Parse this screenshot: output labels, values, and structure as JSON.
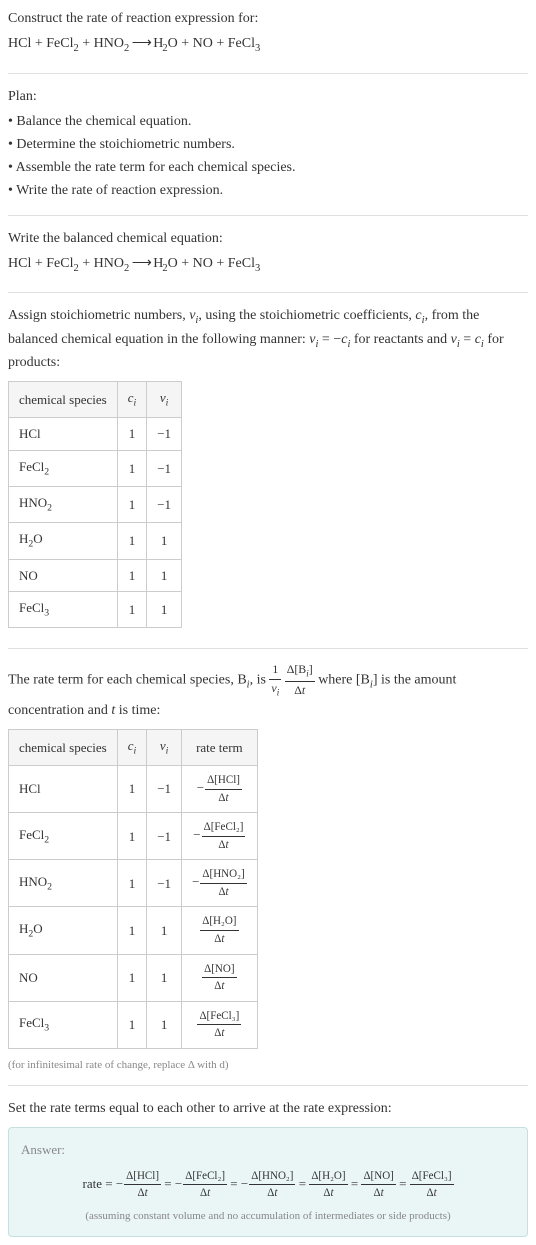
{
  "intro": {
    "line1": "Construct the rate of reaction expression for:",
    "equation_parts": [
      "HCl + FeCl",
      "2",
      " + HNO",
      "2",
      "  ⟶  H",
      "2",
      "O + NO + FeCl",
      "3"
    ]
  },
  "plan": {
    "heading": "Plan:",
    "items": [
      "• Balance the chemical equation.",
      "• Determine the stoichiometric numbers.",
      "• Assemble the rate term for each chemical species.",
      "• Write the rate of reaction expression."
    ]
  },
  "balanced": {
    "heading": "Write the balanced chemical equation:",
    "equation_parts": [
      "HCl + FeCl",
      "2",
      " + HNO",
      "2",
      "  ⟶  H",
      "2",
      "O + NO + FeCl",
      "3"
    ]
  },
  "stoich": {
    "text_before": "Assign stoichiometric numbers, ",
    "nu_i": "ν",
    "sub_i": "i",
    "text_mid1": ", using the stoichiometric coefficients, ",
    "c_i": "c",
    "text_mid2": ", from the balanced chemical equation in the following manner: ",
    "eq1": "ν",
    "eq1_mid": " = −",
    "eq1_end": "c",
    "text_mid3": " for reactants and ",
    "eq2": "ν",
    "eq2_mid": " = ",
    "eq2_end": "c",
    "text_end": " for products:",
    "table": {
      "headers": [
        "chemical species",
        "c_i",
        "ν_i"
      ],
      "rows": [
        {
          "species": "HCl",
          "sub": "",
          "c": "1",
          "nu": "−1"
        },
        {
          "species": "FeCl",
          "sub": "2",
          "c": "1",
          "nu": "−1"
        },
        {
          "species": "HNO",
          "sub": "2",
          "c": "1",
          "nu": "−1"
        },
        {
          "species": "H",
          "sub": "2",
          "species2": "O",
          "c": "1",
          "nu": "1"
        },
        {
          "species": "NO",
          "sub": "",
          "c": "1",
          "nu": "1"
        },
        {
          "species": "FeCl",
          "sub": "3",
          "c": "1",
          "nu": "1"
        }
      ]
    }
  },
  "rateterm": {
    "text_before": "The rate term for each chemical species, B",
    "text_mid1": ", is ",
    "frac1_num": "1",
    "frac1_den_nu": "ν",
    "frac2_num_delta": "Δ[B",
    "frac2_num_end": "]",
    "frac2_den": "Δt",
    "text_mid2": " where [B",
    "text_mid3": "] is the amount concentration and ",
    "t_var": "t",
    "text_end": " is time:",
    "table": {
      "headers": [
        "chemical species",
        "c_i",
        "ν_i",
        "rate term"
      ],
      "rows": [
        {
          "species": "HCl",
          "sub": "",
          "c": "1",
          "nu": "−1",
          "neg": "−",
          "num": "Δ[HCl]",
          "den": "Δt"
        },
        {
          "species": "FeCl",
          "sub": "2",
          "c": "1",
          "nu": "−1",
          "neg": "−",
          "num": "Δ[FeCl₂]",
          "den": "Δt"
        },
        {
          "species": "HNO",
          "sub": "2",
          "c": "1",
          "nu": "−1",
          "neg": "−",
          "num": "Δ[HNO₂]",
          "den": "Δt"
        },
        {
          "species": "H",
          "sub": "2",
          "species2": "O",
          "c": "1",
          "nu": "1",
          "neg": "",
          "num": "Δ[H₂O]",
          "den": "Δt"
        },
        {
          "species": "NO",
          "sub": "",
          "c": "1",
          "nu": "1",
          "neg": "",
          "num": "Δ[NO]",
          "den": "Δt"
        },
        {
          "species": "FeCl",
          "sub": "3",
          "c": "1",
          "nu": "1",
          "neg": "",
          "num": "Δ[FeCl₃]",
          "den": "Δt"
        }
      ]
    },
    "note": "(for infinitesimal rate of change, replace Δ with d)"
  },
  "final": {
    "heading": "Set the rate terms equal to each other to arrive at the rate expression:"
  },
  "answer": {
    "label": "Answer:",
    "rate_label": "rate = ",
    "terms": [
      {
        "neg": "−",
        "num": "Δ[HCl]",
        "den": "Δt"
      },
      {
        "neg": "−",
        "num": "Δ[FeCl₂]",
        "den": "Δt"
      },
      {
        "neg": "−",
        "num": "Δ[HNO₂]",
        "den": "Δt"
      },
      {
        "neg": "",
        "num": "Δ[H₂O]",
        "den": "Δt"
      },
      {
        "neg": "",
        "num": "Δ[NO]",
        "den": "Δt"
      },
      {
        "neg": "",
        "num": "Δ[FeCl₃]",
        "den": "Δt"
      }
    ],
    "eq": " = ",
    "note": "(assuming constant volume and no accumulation of intermediates or side products)"
  }
}
